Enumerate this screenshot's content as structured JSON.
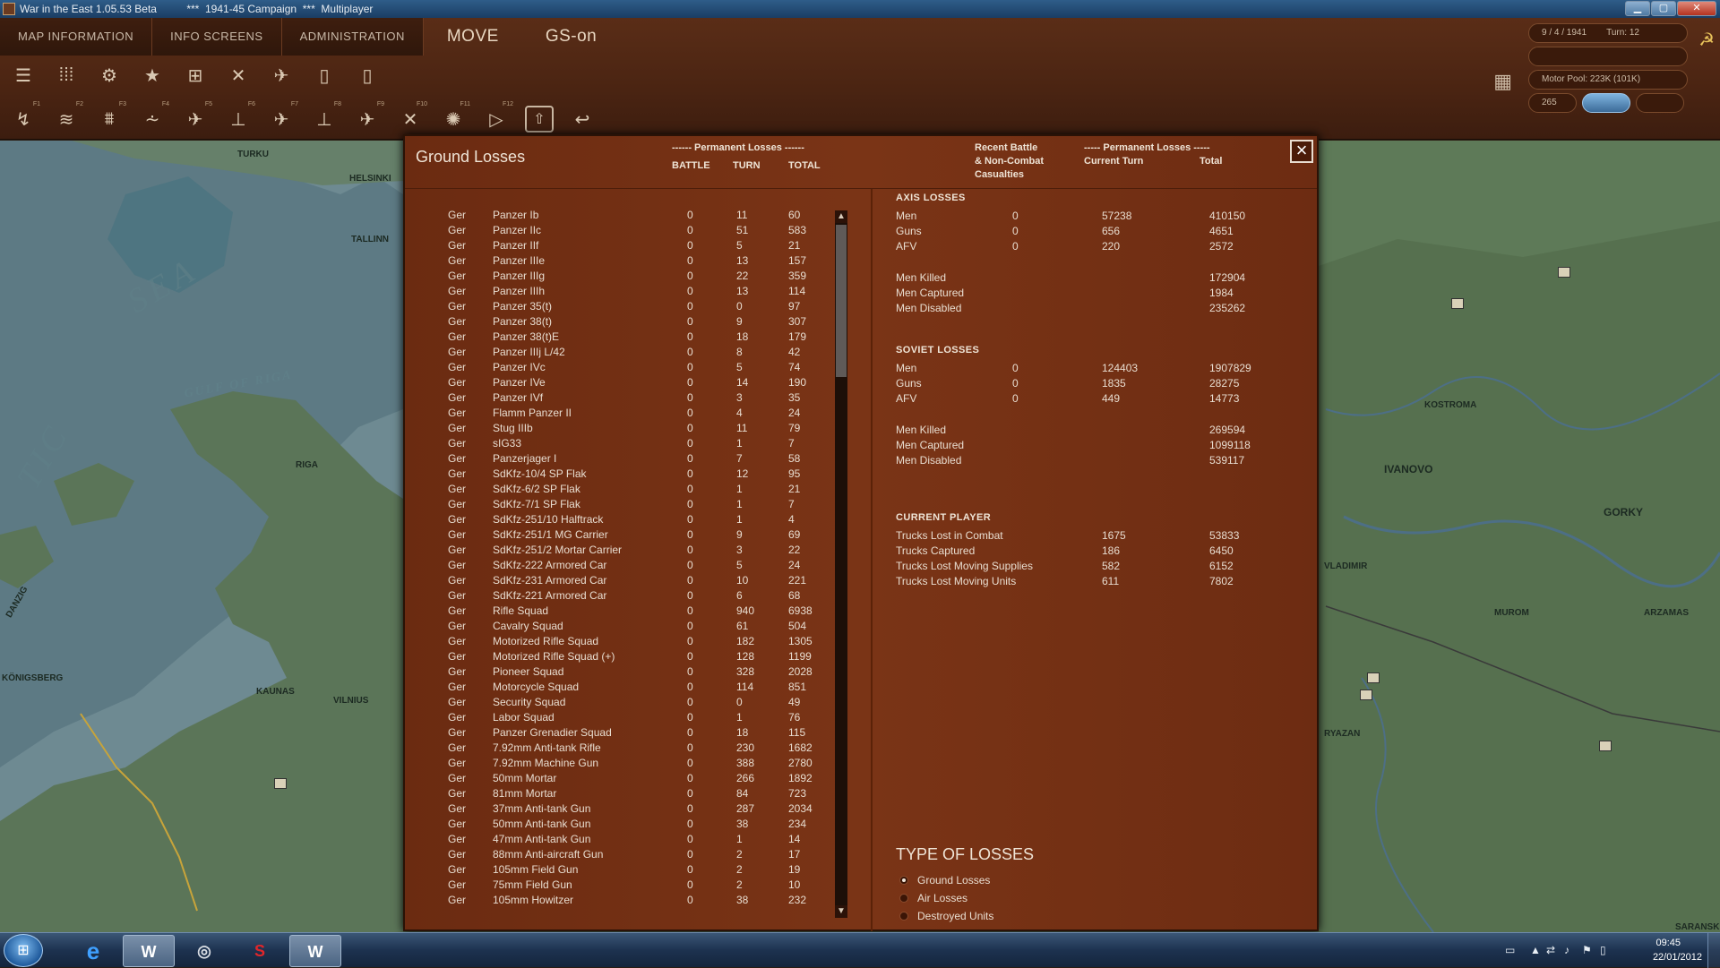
{
  "window": {
    "title": "War in the East 1.05.53 Beta          ***  1941-45 Campaign  ***  Multiplayer"
  },
  "menu": {
    "tabs": [
      "MAP INFORMATION",
      "INFO SCREENS",
      "ADMINISTRATION"
    ],
    "move": "MOVE",
    "gs": "GS-on"
  },
  "status": {
    "date": "9 / 4 / 1941",
    "turn": "Turn: 12",
    "motor_pool": "Motor Pool: 223K (101K)",
    "value_265": "265"
  },
  "dialog": {
    "title": "Ground Losses",
    "hdr_perm_left": "------ Permanent Losses ------",
    "hdr_battle": "BATTLE",
    "hdr_turn": "TURN",
    "hdr_total": "TOTAL",
    "hdr_recent": "Recent Battle\n& Non-Combat\nCasualties",
    "hdr_perm_right": "----- Permanent Losses -----",
    "hdr_current_turn": "Current Turn",
    "hdr_total_right": "Total"
  },
  "units": [
    [
      "Ger",
      "Panzer Ib",
      "0",
      "11",
      "60"
    ],
    [
      "Ger",
      "Panzer IIc",
      "0",
      "51",
      "583"
    ],
    [
      "Ger",
      "Panzer IIf",
      "0",
      "5",
      "21"
    ],
    [
      "Ger",
      "Panzer IIIe",
      "0",
      "13",
      "157"
    ],
    [
      "Ger",
      "Panzer IIIg",
      "0",
      "22",
      "359"
    ],
    [
      "Ger",
      "Panzer IIIh",
      "0",
      "13",
      "114"
    ],
    [
      "Ger",
      "Panzer 35(t)",
      "0",
      "0",
      "97"
    ],
    [
      "Ger",
      "Panzer 38(t)",
      "0",
      "9",
      "307"
    ],
    [
      "Ger",
      "Panzer 38(t)E",
      "0",
      "18",
      "179"
    ],
    [
      "Ger",
      "Panzer IIIj L/42",
      "0",
      "8",
      "42"
    ],
    [
      "Ger",
      "Panzer IVc",
      "0",
      "5",
      "74"
    ],
    [
      "Ger",
      "Panzer IVe",
      "0",
      "14",
      "190"
    ],
    [
      "Ger",
      "Panzer IVf",
      "0",
      "3",
      "35"
    ],
    [
      "Ger",
      "Flamm Panzer II",
      "0",
      "4",
      "24"
    ],
    [
      "Ger",
      "Stug IIIb",
      "0",
      "11",
      "79"
    ],
    [
      "Ger",
      "sIG33",
      "0",
      "1",
      "7"
    ],
    [
      "Ger",
      "Panzerjager I",
      "0",
      "7",
      "58"
    ],
    [
      "Ger",
      "SdKfz-10/4 SP Flak",
      "0",
      "12",
      "95"
    ],
    [
      "Ger",
      "SdKfz-6/2 SP Flak",
      "0",
      "1",
      "21"
    ],
    [
      "Ger",
      "SdKfz-7/1 SP Flak",
      "0",
      "1",
      "7"
    ],
    [
      "Ger",
      "SdKfz-251/10 Halftrack",
      "0",
      "1",
      "4"
    ],
    [
      "Ger",
      "SdKfz-251/1 MG Carrier",
      "0",
      "9",
      "69"
    ],
    [
      "Ger",
      "SdKfz-251/2 Mortar Carrier",
      "0",
      "3",
      "22"
    ],
    [
      "Ger",
      "SdKfz-222 Armored Car",
      "0",
      "5",
      "24"
    ],
    [
      "Ger",
      "SdKfz-231 Armored Car",
      "0",
      "10",
      "221"
    ],
    [
      "Ger",
      "SdKfz-221 Armored Car",
      "0",
      "6",
      "68"
    ],
    [
      "Ger",
      "Rifle Squad",
      "0",
      "940",
      "6938"
    ],
    [
      "Ger",
      "Cavalry Squad",
      "0",
      "61",
      "504"
    ],
    [
      "Ger",
      "Motorized Rifle Squad",
      "0",
      "182",
      "1305"
    ],
    [
      "Ger",
      "Motorized Rifle Squad (+)",
      "0",
      "128",
      "1199"
    ],
    [
      "Ger",
      "Pioneer Squad",
      "0",
      "328",
      "2028"
    ],
    [
      "Ger",
      "Motorcycle Squad",
      "0",
      "114",
      "851"
    ],
    [
      "Ger",
      "Security Squad",
      "0",
      "0",
      "49"
    ],
    [
      "Ger",
      "Labor Squad",
      "0",
      "1",
      "76"
    ],
    [
      "Ger",
      "Panzer Grenadier Squad",
      "0",
      "18",
      "115"
    ],
    [
      "Ger",
      "7.92mm Anti-tank Rifle",
      "0",
      "230",
      "1682"
    ],
    [
      "Ger",
      "7.92mm Machine Gun",
      "0",
      "388",
      "2780"
    ],
    [
      "Ger",
      "50mm Mortar",
      "0",
      "266",
      "1892"
    ],
    [
      "Ger",
      "81mm Mortar",
      "0",
      "84",
      "723"
    ],
    [
      "Ger",
      "37mm Anti-tank Gun",
      "0",
      "287",
      "2034"
    ],
    [
      "Ger",
      "50mm Anti-tank Gun",
      "0",
      "38",
      "234"
    ],
    [
      "Ger",
      "47mm Anti-tank Gun",
      "0",
      "1",
      "14"
    ],
    [
      "Ger",
      "88mm Anti-aircraft Gun",
      "0",
      "2",
      "17"
    ],
    [
      "Ger",
      "105mm Field Gun",
      "0",
      "2",
      "19"
    ],
    [
      "Ger",
      "75mm Field Gun",
      "0",
      "2",
      "10"
    ],
    [
      "Ger",
      "105mm Howitzer",
      "0",
      "38",
      "232"
    ]
  ],
  "axis": {
    "heading": "AXIS LOSSES",
    "rows": [
      [
        "Men",
        "0",
        "57238",
        "410150"
      ],
      [
        "Guns",
        "0",
        "656",
        "4651"
      ],
      [
        "AFV",
        "0",
        "220",
        "2572"
      ]
    ],
    "sub": [
      [
        "Men Killed",
        "172904"
      ],
      [
        "Men Captured",
        "1984"
      ],
      [
        "Men Disabled",
        "235262"
      ]
    ]
  },
  "soviet": {
    "heading": "SOVIET LOSSES",
    "rows": [
      [
        "Men",
        "0",
        "124403",
        "1907829"
      ],
      [
        "Guns",
        "0",
        "1835",
        "28275"
      ],
      [
        "AFV",
        "0",
        "449",
        "14773"
      ]
    ],
    "sub": [
      [
        "Men Killed",
        "269594"
      ],
      [
        "Men Captured",
        "1099118"
      ],
      [
        "Men Disabled",
        "539117"
      ]
    ]
  },
  "player": {
    "heading": "CURRENT PLAYER",
    "rows": [
      [
        "Trucks Lost in Combat",
        "1675",
        "53833"
      ],
      [
        "Trucks Captured",
        "186",
        "6450"
      ],
      [
        "Trucks Lost Moving Supplies",
        "582",
        "6152"
      ],
      [
        "Trucks Lost Moving Units",
        "611",
        "7802"
      ]
    ]
  },
  "loss_types": {
    "title": "TYPE OF LOSSES",
    "options": [
      "Ground Losses",
      "Air Losses",
      "Destroyed Units"
    ],
    "selected": "Ground Losses"
  },
  "map_labels": {
    "helsinki": "HELSINKI",
    "turku": "TURKU",
    "tallinn": "TALLINN",
    "sea": "SEA",
    "tic": "TIC",
    "gulf": "GULF OF RIGA",
    "riga": "RIGA",
    "danzig": "DANZIG",
    "kaunas": "KAUNAS",
    "vilnius": "VILNIUS",
    "koenigsberg": "KÖNIGSBERG",
    "kostroma": "KOSTROMA",
    "ivanovo": "IVANOVO",
    "gorky": "GORKY",
    "vladimir": "VLADIMIR",
    "murom": "MUROM",
    "arzamas": "ARZAMAS",
    "ryazan": "RYAZAN",
    "saransk": "SARANSK"
  },
  "taskbar": {
    "time": "09:45",
    "date": "22/01/2012"
  },
  "colors": {
    "dialog_bg": "#7a3416",
    "topbar_bg": "#4a2412",
    "text": "#e8ddd0",
    "taskbar": "#1d3250"
  }
}
